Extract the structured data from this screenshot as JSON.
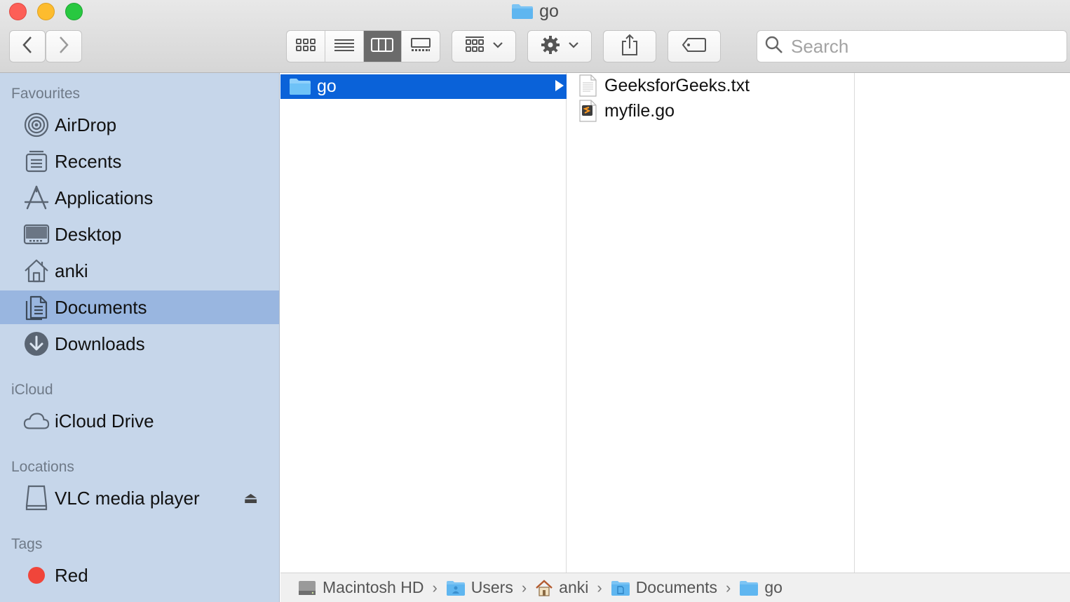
{
  "window": {
    "title": "go"
  },
  "toolbar": {
    "search_placeholder": "Search"
  },
  "sidebar": {
    "sections": {
      "favourites": "Favourites",
      "icloud": "iCloud",
      "locations": "Locations",
      "tags": "Tags"
    },
    "favourites": [
      {
        "label": "AirDrop",
        "icon": "airdrop-icon"
      },
      {
        "label": "Recents",
        "icon": "recents-icon"
      },
      {
        "label": "Applications",
        "icon": "applications-icon"
      },
      {
        "label": "Desktop",
        "icon": "desktop-icon"
      },
      {
        "label": "anki",
        "icon": "home-icon"
      },
      {
        "label": "Documents",
        "icon": "documents-icon",
        "selected": true
      },
      {
        "label": "Downloads",
        "icon": "downloads-icon"
      }
    ],
    "icloud": [
      {
        "label": "iCloud Drive",
        "icon": "cloud-icon"
      }
    ],
    "locations": [
      {
        "label": "VLC media player",
        "icon": "drive-icon",
        "eject": "⏏"
      }
    ],
    "tags": [
      {
        "label": "Red",
        "color": "#f0453a"
      }
    ]
  },
  "columns": {
    "col1": [
      {
        "label": "go",
        "type": "folder",
        "selected": true
      }
    ],
    "col2": [
      {
        "label": "GeeksforGeeks.txt",
        "type": "text-file"
      },
      {
        "label": "myfile.go",
        "type": "go-file"
      }
    ]
  },
  "pathbar": {
    "crumbs": [
      "Macintosh HD",
      "Users",
      "anki",
      "Documents",
      "go"
    ],
    "separator": "›"
  },
  "colors": {
    "selection": "#0a62d9",
    "sidebar_bg": "#c6d6ea",
    "sidebar_selected": "#99b6e0",
    "folder": "#5fb6f0"
  }
}
